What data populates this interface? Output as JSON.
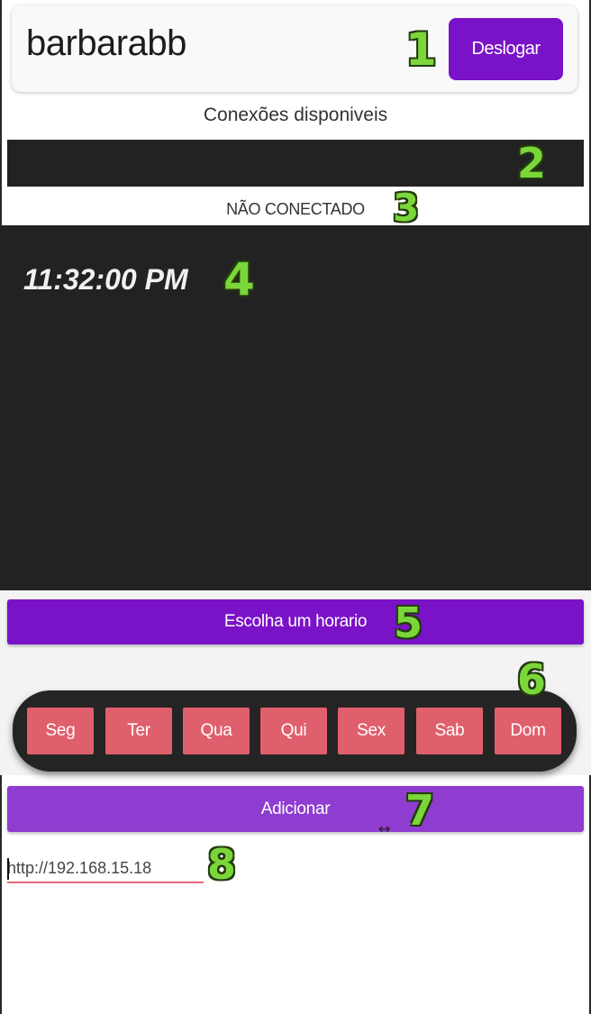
{
  "header": {
    "username": "barbarabb",
    "logout_label": "Deslogar"
  },
  "connections": {
    "title": "Conexões disponiveis",
    "status": "NÃO CONECTADO"
  },
  "clock": {
    "time": "11:32:00 PM"
  },
  "schedule": {
    "choose_label": "Escolha um horario",
    "days": [
      "Seg",
      "Ter",
      "Qua",
      "Qui",
      "Sex",
      "Sab",
      "Dom"
    ],
    "add_label": "Adicionar"
  },
  "server": {
    "url": "http://192.168.15.18"
  },
  "annotations": [
    "1",
    "2",
    "3",
    "4",
    "5",
    "6",
    "7",
    "8"
  ],
  "colors": {
    "accent_purple": "#7a12c7",
    "add_button_purple": "#8f3cd0",
    "day_button": "#e05f6c",
    "dark_panel": "#222222",
    "annotation_green": "#7bd63a"
  }
}
